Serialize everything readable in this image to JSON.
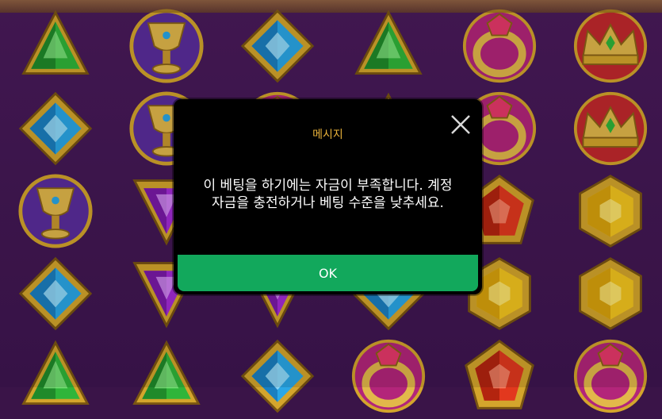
{
  "dialog": {
    "title": "메시지",
    "message_line1": "이 베팅을 하기에는 자금이 부족합니다. 계정",
    "message_line2": "자금을 충전하거나 베팅 수준을 낮추세요.",
    "ok_label": "OK"
  },
  "colors": {
    "dialog_title": "#e9b23a",
    "ok_button": "#12a85c",
    "reel_background": "#4a1b5b"
  },
  "reels": [
    [
      "green-triangle-gem",
      "blue-diamond-gem",
      "golden-chalice",
      "blue-diamond-gem",
      "green-triangle-gem"
    ],
    [
      "golden-chalice",
      "golden-chalice",
      "purple-triangle-gem",
      "purple-triangle-gem",
      "green-triangle-gem"
    ],
    [
      "blue-diamond-gem",
      "ruby-ring",
      "purple-triangle-gem",
      "purple-triangle-gem",
      "blue-diamond-gem"
    ],
    [
      "green-triangle-gem",
      "green-triangle-gem",
      "blue-diamond-gem",
      "blue-diamond-gem",
      "ruby-ring"
    ],
    [
      "ruby-ring",
      "ruby-ring",
      "red-pentagon-gem",
      "yellow-hexagon-gem",
      "red-pentagon-gem"
    ],
    [
      "red-crown",
      "red-crown",
      "yellow-hexagon-gem",
      "yellow-hexagon-gem",
      "ruby-ring"
    ]
  ]
}
